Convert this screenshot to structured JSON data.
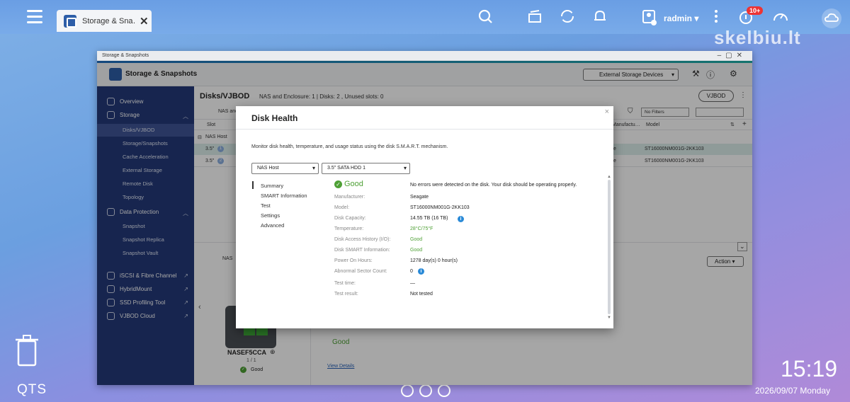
{
  "topbar": {
    "tab_label": "Storage & Sna…",
    "user": "radmin",
    "notif_badge": "10+",
    "watermark": "skelbiu.lt"
  },
  "desktop": {
    "os_label": "QTS",
    "time": "15:19",
    "date": "2026/09/07 Monday"
  },
  "window": {
    "titlebar": "Storage & Snapshots",
    "app_name": "Storage & Snapshots",
    "external_storage": "External Storage Devices",
    "page_title": "Disks/VJBOD",
    "page_sub": "NAS and Enclosure: 1 | Disks: 2 , Unused slots: 0",
    "vjbod_button": "VJBOD",
    "nas_col": "NAS and",
    "filter_dd": "No Filters",
    "col_slot": "Slot",
    "col_manufacturer": "Manufactu…",
    "col_model": "Model",
    "nas_host_group": "NAS Host",
    "rows": [
      {
        "slot": "3.5\"",
        "num": "1",
        "mfr": "te",
        "model": "ST16000NM001G-2KK103"
      },
      {
        "slot": "3.5\"",
        "num": "2",
        "mfr": "te",
        "model": "ST16000NM001G-2KK103"
      }
    ],
    "nas_label": "NAS",
    "device_name": "NASEF5CCA",
    "device_count": "1 / 1",
    "device_status": "Good",
    "bottom_good": "Good",
    "view_details": "View Details",
    "action_button": "Action"
  },
  "sidebar": {
    "overview": "Overview",
    "storage": "Storage",
    "storage_items": [
      "Disks/VJBOD",
      "Storage/Snapshots",
      "Cache Acceleration",
      "External Storage",
      "Remote Disk",
      "Topology"
    ],
    "data_protection": "Data Protection",
    "dp_items": [
      "Snapshot",
      "Snapshot Replica",
      "Snapshot Vault"
    ],
    "links": [
      "iSCSI & Fibre Channel",
      "HybridMount",
      "SSD Profiling Tool",
      "VJBOD Cloud"
    ]
  },
  "modal": {
    "title": "Disk Health",
    "close": "×",
    "description": "Monitor disk health, temperature, and usage status using the disk S.M.A.R.T. mechanism.",
    "select_host": "NAS Host",
    "select_disk": "3.5\" SATA HDD 1",
    "nav": [
      "Summary",
      "SMART Information",
      "Test",
      "Settings",
      "Advanced"
    ],
    "status": "Good",
    "status_message": "No errors were detected on the disk. Your disk should be operating properly.",
    "fields": [
      {
        "label": "Manufacturer:",
        "value": "Seagate"
      },
      {
        "label": "Model:",
        "value": "ST16000NM001G-2KK103"
      },
      {
        "label": "Disk Capacity:",
        "value": "14.55 TB (16 TB)"
      },
      {
        "label": "Temperature:",
        "value": "28°C/75°F"
      },
      {
        "label": "Disk Access History (I/O):",
        "value": "Good"
      },
      {
        "label": "Disk SMART Information:",
        "value": "Good"
      },
      {
        "label": "Power On Hours:",
        "value": "1278 day(s) 0 hour(s)"
      },
      {
        "label": "Abnormal Sector Count:",
        "value": "0"
      },
      {
        "label": "Test time:",
        "value": "—"
      },
      {
        "label": "Test result:",
        "value": "Not tested"
      }
    ]
  },
  "colors": {
    "sidebar": "#243a7a",
    "good_green": "#4ea035",
    "info_blue": "#2a8ad7"
  }
}
